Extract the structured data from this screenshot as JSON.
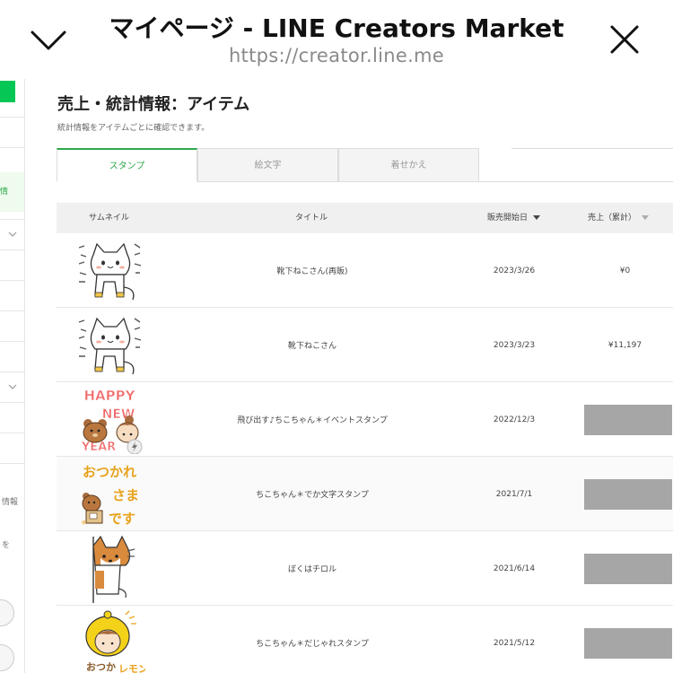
{
  "browser": {
    "title": "マイページ - LINE Creators Market",
    "url": "https://creator.line.me",
    "icons": {
      "collapse": "chevron-down-icon",
      "close": "close-icon"
    }
  },
  "sidebar": {
    "highlight_text": "情",
    "text_1": "情報",
    "text_2": "を"
  },
  "page": {
    "title": "売上・統計情報：アイテム",
    "description": "統計情報をアイテムごとに確認できます。"
  },
  "tabs": [
    {
      "label": "スタンプ",
      "active": true
    },
    {
      "label": "絵文字",
      "active": false
    },
    {
      "label": "着せかえ",
      "active": false
    }
  ],
  "table": {
    "headers": {
      "thumbnail": "サムネイル",
      "title": "タイトル",
      "release_date": "販売開始日",
      "sales": "売上（累計）"
    },
    "rows": [
      {
        "title": "靴下ねこさん(再販)",
        "date": "2023/3/26",
        "sales": "¥0",
        "sales_hidden": false,
        "thumb": "cat-sticker"
      },
      {
        "title": "靴下ねこさん",
        "date": "2023/3/23",
        "sales": "¥11,197",
        "sales_hidden": false,
        "thumb": "cat-sticker"
      },
      {
        "title": "飛び出す♪ちこちゃん＊イベントスタンプ",
        "date": "2022/12/3",
        "sales": "",
        "sales_hidden": true,
        "thumb": "happy-new-year-sticker",
        "thumb_text": "HAPPY NEW YEAR"
      },
      {
        "title": "ちこちゃん＊でか文字スタンプ",
        "date": "2021/7/1",
        "sales": "",
        "sales_hidden": true,
        "thumb": "otsukare-sticker",
        "thumb_text": "おつかれさまです"
      },
      {
        "title": "ぼくはチロル",
        "date": "2021/6/14",
        "sales": "",
        "sales_hidden": true,
        "thumb": "shiba-dog-sticker"
      },
      {
        "title": "ちこちゃん＊だじゃれスタンプ",
        "date": "2021/5/12",
        "sales": "",
        "sales_hidden": true,
        "thumb": "lemon-girl-sticker",
        "thumb_text": "おつかレモン"
      }
    ]
  },
  "colors": {
    "accent": "#06c755",
    "tab_active": "#2ca84a",
    "redaction": "#a6a6a6"
  }
}
